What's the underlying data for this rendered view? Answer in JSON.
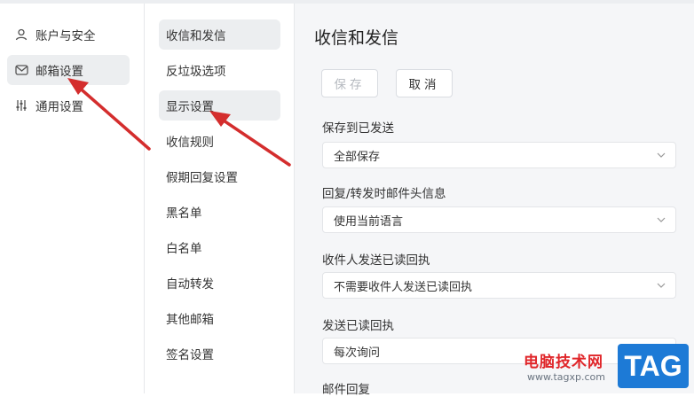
{
  "left_nav": {
    "items": [
      {
        "label": "账户与安全",
        "icon": "user-icon"
      },
      {
        "label": "邮箱设置",
        "icon": "mailbox-icon"
      },
      {
        "label": "通用设置",
        "icon": "sliders-icon"
      }
    ]
  },
  "sub_nav": {
    "items": [
      {
        "label": "收信和发信"
      },
      {
        "label": "反垃圾选项"
      },
      {
        "label": "显示设置"
      },
      {
        "label": "收信规则"
      },
      {
        "label": "假期回复设置"
      },
      {
        "label": "黑名单"
      },
      {
        "label": "白名单"
      },
      {
        "label": "自动转发"
      },
      {
        "label": "其他邮箱"
      },
      {
        "label": "签名设置"
      }
    ]
  },
  "content": {
    "title": "收信和发信",
    "save_label": "保存",
    "cancel_label": "取消",
    "fields": [
      {
        "label": "保存到已发送",
        "value": "全部保存"
      },
      {
        "label": "回复/转发时邮件头信息",
        "value": "使用当前语言"
      },
      {
        "label": "收件人发送已读回执",
        "value": "不需要收件人发送已读回执"
      },
      {
        "label": "发送已读回执",
        "value": "每次询问"
      },
      {
        "label": "邮件回复",
        "value": ""
      }
    ]
  },
  "watermark": {
    "site_name": "电脑技术网",
    "url": "www.tagxp.com",
    "tag": "TAG"
  },
  "colors": {
    "arrow": "#d42d2d",
    "active_bg": "#eceef0",
    "content_bg": "#f5f6f8"
  }
}
